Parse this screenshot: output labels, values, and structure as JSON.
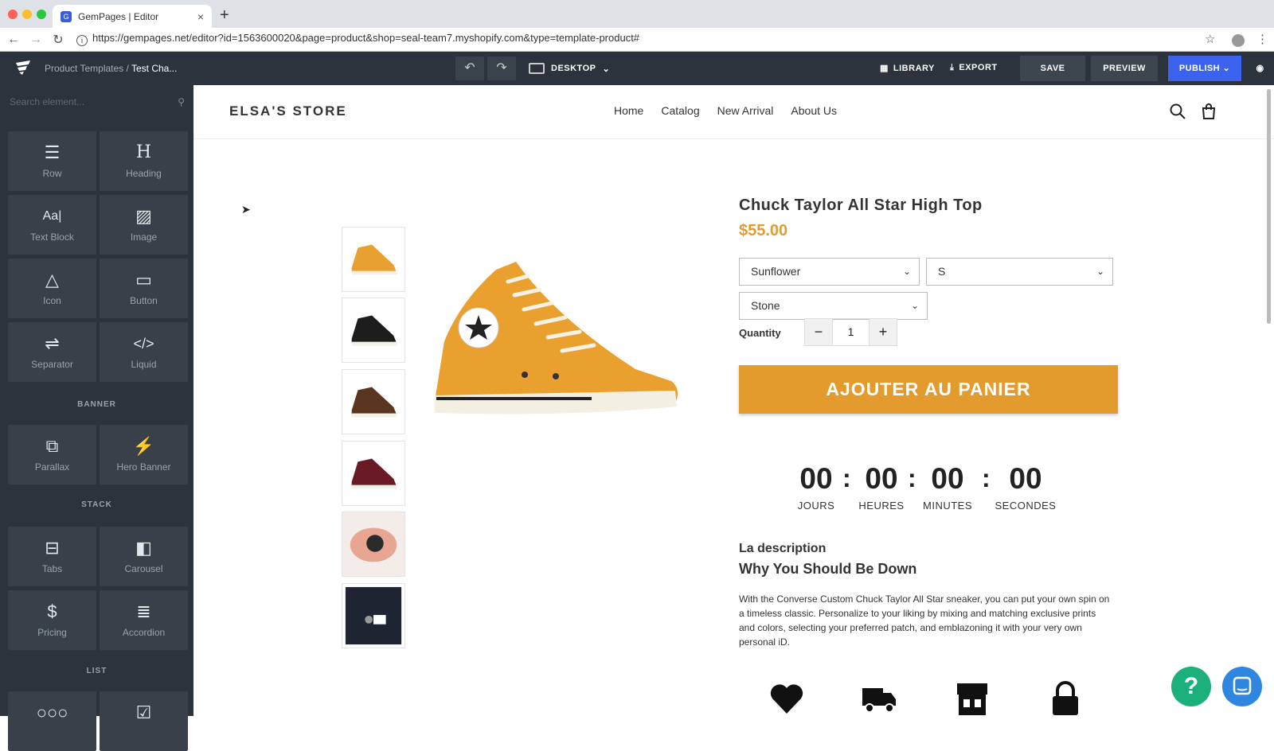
{
  "browser": {
    "tab_title": "GemPages | Editor",
    "url": "https://gempages.net/editor?id=1563600020&page=product&shop=seal-team7.myshopify.com&type=template-product#"
  },
  "editor": {
    "breadcrumb_root": "Product Templates",
    "breadcrumb_sep": "/",
    "breadcrumb_current": "Test Cha...",
    "device": "DESKTOP",
    "library": "LIBRARY",
    "export": "EXPORT",
    "save": "SAVE",
    "preview": "PREVIEW",
    "publish": "PUBLISH"
  },
  "sidebar": {
    "search_placeholder": "Search element...",
    "elements": [
      {
        "label": "Row",
        "icon": "row-icon"
      },
      {
        "label": "Heading",
        "icon": "heading-icon"
      },
      {
        "label": "Text Block",
        "icon": "text-block-icon"
      },
      {
        "label": "Image",
        "icon": "image-icon"
      },
      {
        "label": "Icon",
        "icon": "shapes-icon"
      },
      {
        "label": "Button",
        "icon": "button-icon"
      },
      {
        "label": "Separator",
        "icon": "separator-icon"
      },
      {
        "label": "Liquid",
        "icon": "code-icon"
      }
    ],
    "banner_label": "BANNER",
    "banner": [
      {
        "label": "Parallax",
        "icon": "parallax-icon"
      },
      {
        "label": "Hero Banner",
        "icon": "hero-banner-icon"
      }
    ],
    "stack_label": "STACK",
    "stack": [
      {
        "label": "Tabs",
        "icon": "tabs-icon"
      },
      {
        "label": "Carousel",
        "icon": "carousel-icon"
      },
      {
        "label": "Pricing",
        "icon": "pricing-icon"
      },
      {
        "label": "Accordion",
        "icon": "accordion-icon"
      }
    ],
    "list_label": "LIST"
  },
  "store": {
    "name": "ELSA'S STORE",
    "nav": [
      "Home",
      "Catalog",
      "New Arrival",
      "About Us"
    ]
  },
  "product": {
    "title": "Chuck Taylor All Star High Top",
    "price": "$55.00",
    "option_color": "Sunflower",
    "option_size": "S",
    "option_material": "Stone",
    "quantity_label": "Quantity",
    "quantity": "1",
    "add_to_cart": "AJOUTER AU PANIER",
    "countdown": {
      "days": "00",
      "hours": "00",
      "minutes": "00",
      "seconds": "00",
      "days_label": "JOURS",
      "hours_label": "HEURES",
      "minutes_label": "MINUTES",
      "seconds_label": "SECONDES"
    },
    "desc_heading": "La description",
    "desc_subheading": "Why You Should Be Down",
    "desc_text": "With the Converse Custom Chuck Taylor All Star sneaker, you can put your own spin on a timeless classic. Personalize to your liking by mixing and matching exclusive prints and colors, selecting your preferred patch, and emblazoning it with your very own personal iD.",
    "thumbnails": [
      "yellow",
      "black",
      "brown",
      "maroon",
      "watch",
      "suit"
    ]
  },
  "colors": {
    "accent": "#e39b2e",
    "publish": "#3b63f0",
    "editor_bg": "#2c333c"
  }
}
